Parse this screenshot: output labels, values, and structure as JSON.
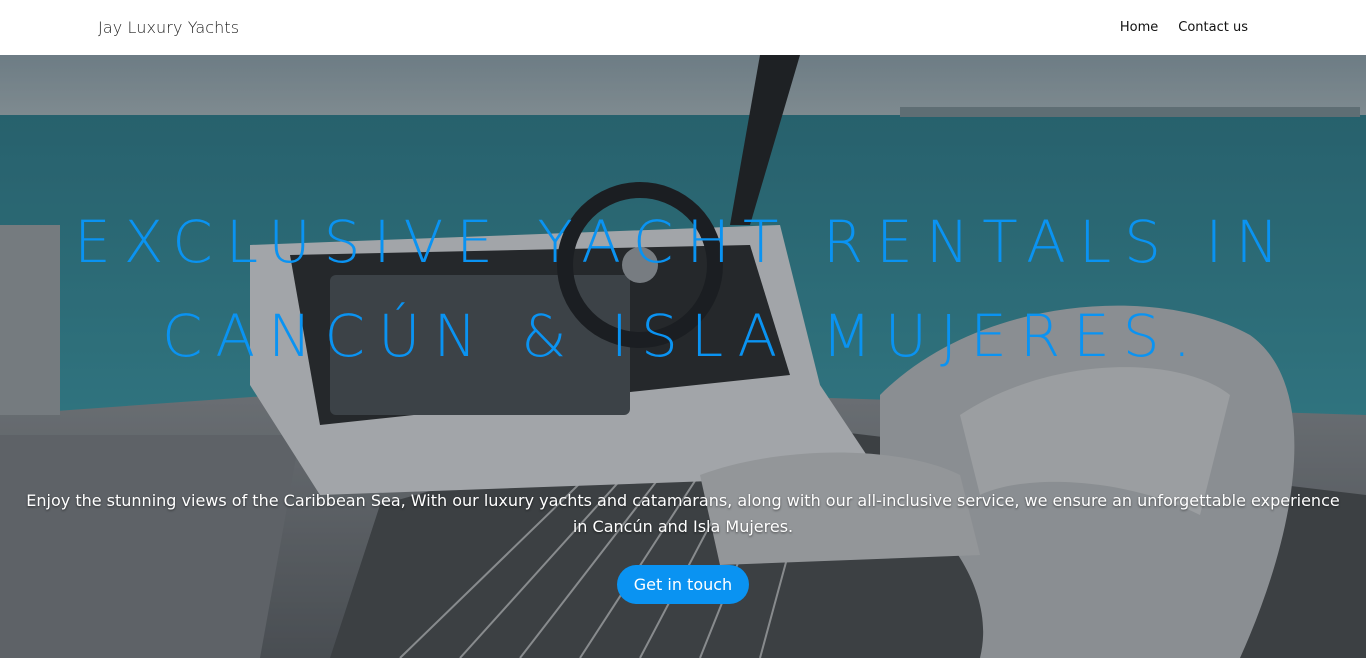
{
  "nav": {
    "brand": "Jay Luxury Yachts",
    "links": [
      "Home",
      "Contact us"
    ]
  },
  "hero": {
    "title_line1": "EXCLUSIVE YACHT RENTALS IN",
    "title_line2": "CANCÚN & ISLA MUJERES.",
    "description": "Enjoy the stunning views of the Caribbean Sea, With our luxury yachts and catamarans, along with our all-inclusive service, we ensure an unforgettable experience in Cancún and Isla Mujeres.",
    "cta_label": "Get in touch",
    "accent_color": "#0a93f2",
    "background_image": "yacht-helm-photo"
  }
}
